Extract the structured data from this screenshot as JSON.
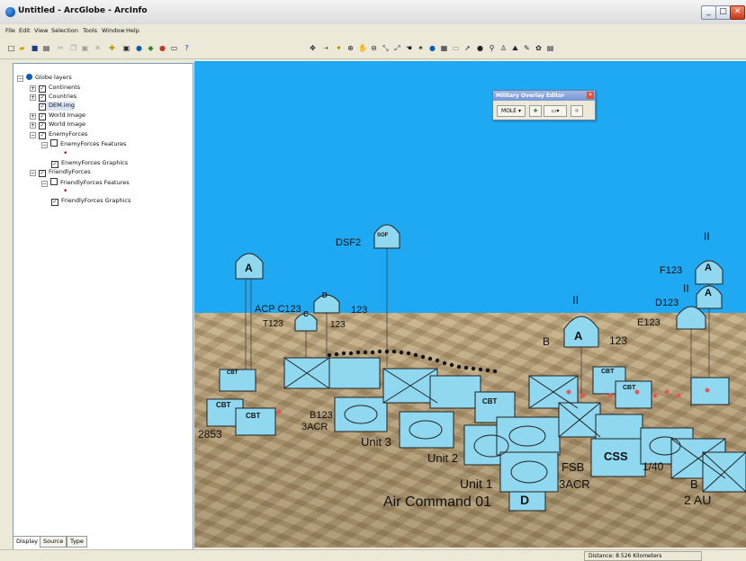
{
  "window": {
    "title": "Untitled - ArcGlobe - ArcInfo",
    "minimize": "_",
    "maximize": "□",
    "close": "✕"
  },
  "menu": [
    "File",
    "Edit",
    "View",
    "Selection",
    "Tools",
    "Window",
    "Help"
  ],
  "toc": {
    "root": "Globe layers",
    "layers": [
      {
        "label": "Continents",
        "checked": true
      },
      {
        "label": "Countries",
        "checked": true
      },
      {
        "label": "DEM.img",
        "checked": true
      },
      {
        "label": "World Image",
        "checked": true
      },
      {
        "label": "World Image",
        "checked": true
      },
      {
        "label": "EnemyForces",
        "checked": true
      },
      {
        "label": "EnemyForces Features",
        "checked": false
      },
      {
        "label": "EnemyForces Graphics",
        "checked": true
      },
      {
        "label": "FriendlyForces",
        "checked": true
      },
      {
        "label": "FriendlyForces Features",
        "checked": false
      },
      {
        "label": "FriendlyForces Graphics",
        "checked": true
      }
    ],
    "tabs": [
      "Display",
      "Source",
      "Type"
    ]
  },
  "mo_editor": {
    "title": "Military Overlay Editor",
    "mole_label": "MOLE ▾"
  },
  "status": {
    "distance": "Distance: 8.526 Kilometers"
  },
  "globe": {
    "sky_color": "#1fa9f2",
    "symbol_fill": "#8fd8f0",
    "labels": {
      "dsf2": "DSF2",
      "sof": "SOF",
      "acp": "ACP C123",
      "t123": "T123",
      "n123a": "123",
      "n123b": "123",
      "n123c": "123",
      "b_a": "B",
      "f123": "F123",
      "d123": "D123",
      "e123": "E123",
      "ii_a": "II",
      "ii_b": "II",
      "ii_c": "II",
      "b123": "B123",
      "acr3": "3ACR",
      "acr3b": "3ACR",
      "n2853": "2853",
      "unit3": "Unit 3",
      "unit2": "Unit 2",
      "unit1": "Unit 1",
      "air_command": "Air Command 01",
      "fsb": "FSB",
      "n140": "1/40",
      "b_b": "B",
      "au2": "2 AU",
      "css": "CSS",
      "cbt1": "CBT",
      "cbt2": "CBT",
      "cbt3": "CBT",
      "cbt4": "CBT",
      "cbt5": "CBT",
      "cbt6": "CBT",
      "a1": "A",
      "a2": "A",
      "a3": "A",
      "a4": "A",
      "d1": "D",
      "d2": "D",
      "c1": "C"
    }
  }
}
